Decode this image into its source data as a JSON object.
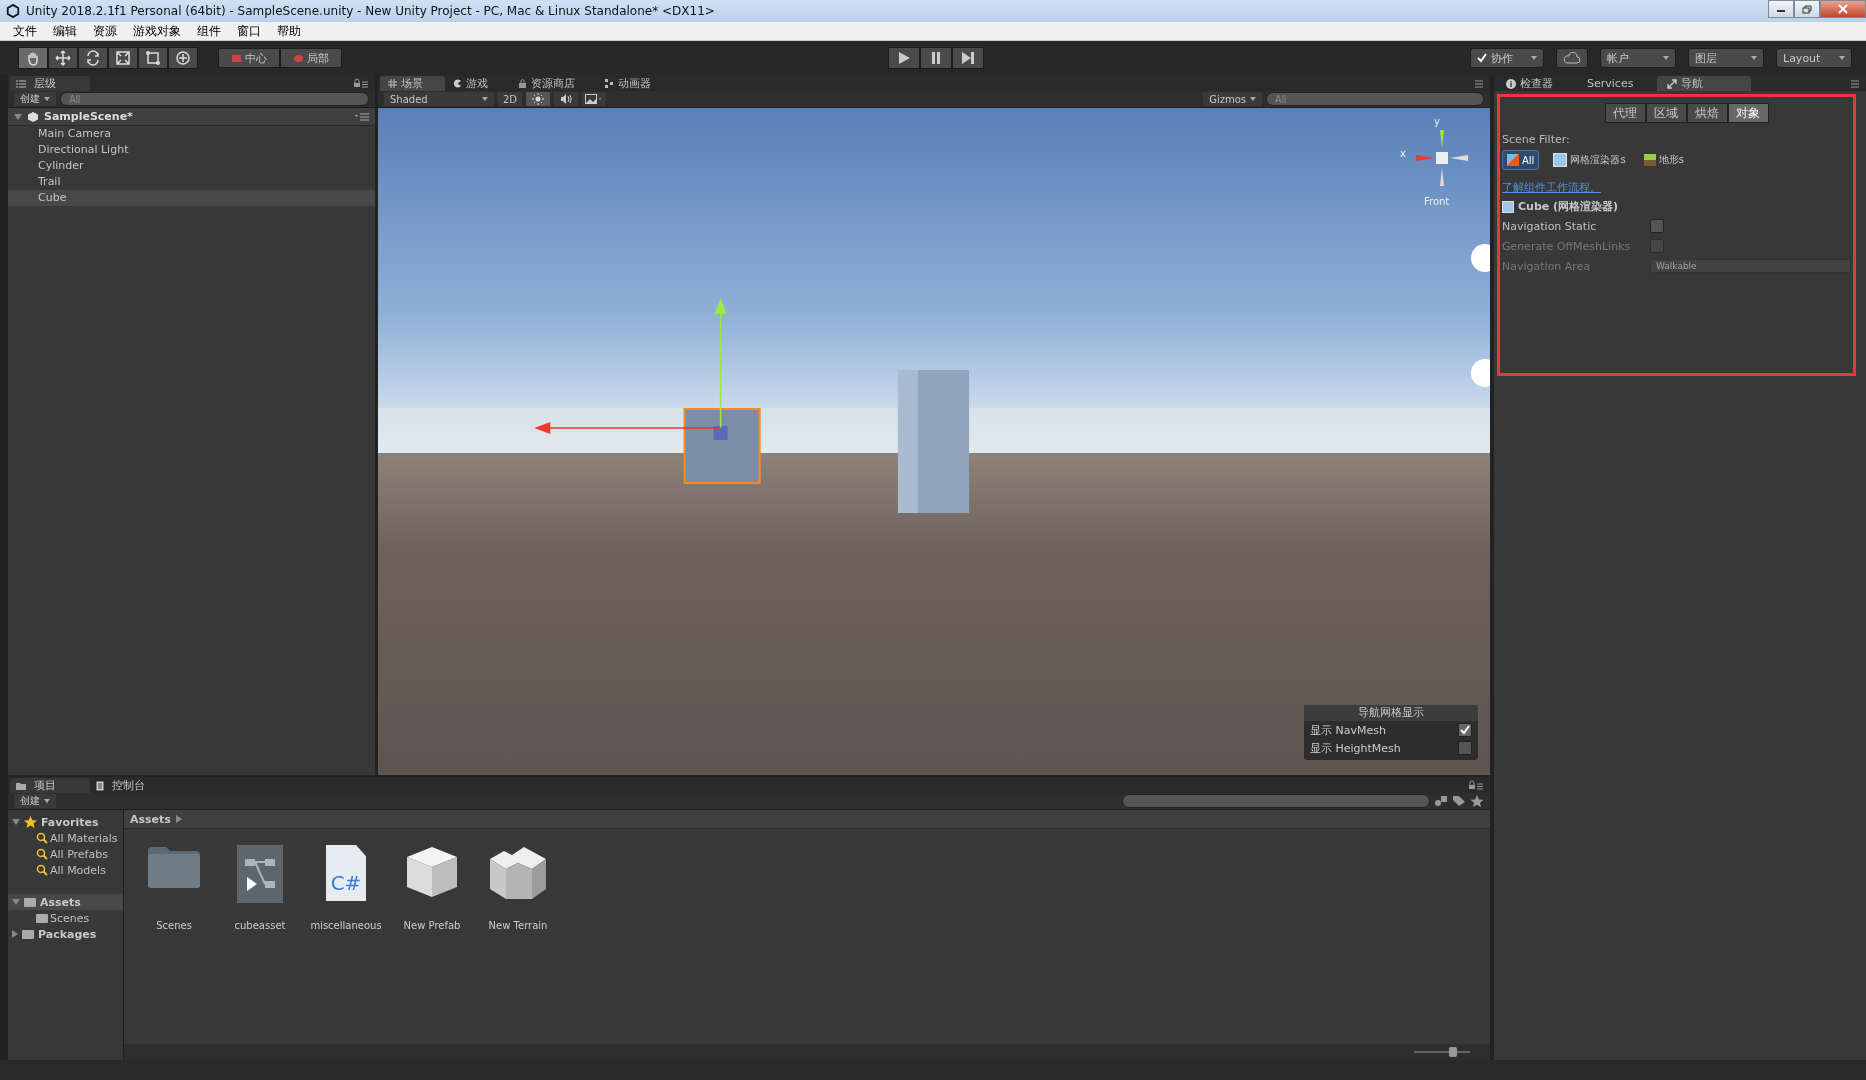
{
  "window": {
    "title": "Unity 2018.2.1f1 Personal (64bit) - SampleScene.unity - New Unity Project - PC, Mac & Linux Standalone* <DX11>"
  },
  "menu": [
    "文件",
    "编辑",
    "资源",
    "游戏对象",
    "组件",
    "窗口",
    "帮助"
  ],
  "toolbar": {
    "tools": [
      {
        "kind": "hand",
        "selected": true
      },
      {
        "kind": "move",
        "selected": false
      },
      {
        "kind": "rotate",
        "selected": false
      },
      {
        "kind": "scale",
        "selected": false
      },
      {
        "kind": "rect",
        "selected": false
      },
      {
        "kind": "transform",
        "selected": false
      }
    ],
    "pivot": [
      "中心",
      "局部"
    ],
    "collab": "协作",
    "account": "帐户",
    "layers": "图层",
    "layout": "Layout"
  },
  "hierarchy": {
    "tab": "层级",
    "create": "创建",
    "search_placeholder": "All",
    "scene": "SampleScene*",
    "items": [
      {
        "label": "Main Camera",
        "selected": false
      },
      {
        "label": "Directional Light",
        "selected": false
      },
      {
        "label": "Cylinder",
        "selected": false
      },
      {
        "label": "Trail",
        "selected": false
      },
      {
        "label": "Cube",
        "selected": true
      }
    ]
  },
  "scene_tabs": [
    {
      "label": "场景",
      "kind": "scene",
      "selected": true
    },
    {
      "label": "游戏",
      "kind": "game",
      "selected": false
    },
    {
      "label": "资源商店",
      "kind": "store",
      "selected": false
    },
    {
      "label": "动画器",
      "kind": "animator",
      "selected": false
    }
  ],
  "scene_toolbar": {
    "shading": "Shaded",
    "mode": "2D",
    "gizmos": "Gizmos",
    "search_placeholder": "All"
  },
  "gizmo": {
    "y_axis": "y",
    "x_axis": "x",
    "view": "Front"
  },
  "nav_overlay": {
    "title": "导航网格显示",
    "options": [
      {
        "label": "显示 NavMesh",
        "checked": true
      },
      {
        "label": "显示 HeightMesh",
        "checked": false
      }
    ]
  },
  "inspector_tabs": [
    {
      "label": "检查器",
      "kind": "inspector",
      "selected": false
    },
    {
      "label": "Services",
      "kind": "services",
      "selected": false
    },
    {
      "label": "导航",
      "kind": "navigation",
      "selected": true
    }
  ],
  "navigation": {
    "tabs": [
      {
        "label": "代理",
        "selected": false
      },
      {
        "label": "区域",
        "selected": false
      },
      {
        "label": "烘焙",
        "selected": false
      },
      {
        "label": "对象",
        "selected": true
      }
    ],
    "scene_filter_label": "Scene Filter:",
    "filters": [
      {
        "label": "All",
        "kind": "all",
        "selected": true
      },
      {
        "label": "网格渲染器s",
        "kind": "mesh",
        "selected": false
      },
      {
        "label": "地形s",
        "kind": "terrain",
        "selected": false
      }
    ],
    "help_link": "了解组件工作流程。",
    "object": "Cube (网格渲染器)",
    "fields": [
      {
        "label": "Navigation Static",
        "kind": "checkbox",
        "checked": false,
        "disabled": false
      },
      {
        "label": "Generate OffMeshLinks",
        "kind": "checkbox",
        "checked": false,
        "disabled": true
      },
      {
        "label": "Navigation Area",
        "kind": "dropdown",
        "value": "Walkable",
        "disabled": true
      }
    ]
  },
  "project": {
    "tabs": [
      {
        "label": "项目",
        "kind": "project",
        "selected": true
      },
      {
        "label": "控制台",
        "kind": "console",
        "selected": false
      }
    ],
    "create": "创建",
    "tree": [
      {
        "label": "Favorites",
        "kind": "favorites",
        "expanded": true,
        "selected": false,
        "children": [
          {
            "label": "All Materials",
            "kind": "search",
            "selected": false
          },
          {
            "label": "All Prefabs",
            "kind": "search",
            "selected": false
          },
          {
            "label": "All Models",
            "kind": "search",
            "selected": false
          }
        ]
      },
      {
        "label": "Assets",
        "kind": "folder",
        "expanded": true,
        "selected": true,
        "children": [
          {
            "label": "Scenes",
            "kind": "folder",
            "selected": false
          }
        ]
      },
      {
        "label": "Packages",
        "kind": "folder",
        "expanded": false,
        "selected": false
      }
    ],
    "breadcrumb": "Assets",
    "assets": [
      {
        "name": "Scenes",
        "kind": "folder"
      },
      {
        "name": "cubeasset",
        "kind": "asset"
      },
      {
        "name": "miscellaneous",
        "kind": "script",
        "icon_text": "C#"
      },
      {
        "name": "New Prefab",
        "kind": "prefab"
      },
      {
        "name": "New Terrain",
        "kind": "terrain"
      }
    ],
    "icon_size": {
      "level": 0.7
    }
  }
}
